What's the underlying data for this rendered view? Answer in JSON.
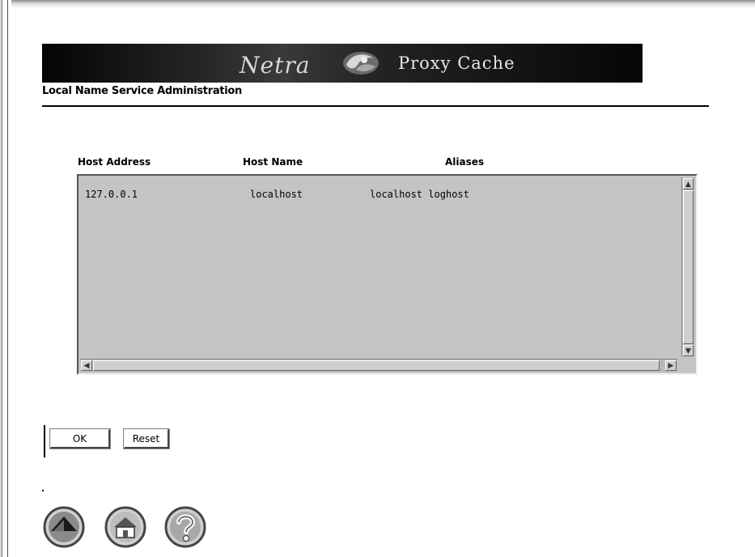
{
  "banner": {
    "brand": "Netra",
    "product": "Proxy Cache"
  },
  "page": {
    "title": "Local Name Service Administration"
  },
  "table": {
    "columns": [
      "Host Address",
      "Host Name",
      "Aliases"
    ],
    "rows": [
      {
        "address": "127.0.0.1",
        "name": "localhost",
        "aliases": "localhost loghost"
      }
    ]
  },
  "buttons": {
    "ok": "OK",
    "reset": "Reset"
  },
  "nav": {
    "icons": [
      "up-arrow-icon",
      "home-icon",
      "help-icon"
    ]
  }
}
